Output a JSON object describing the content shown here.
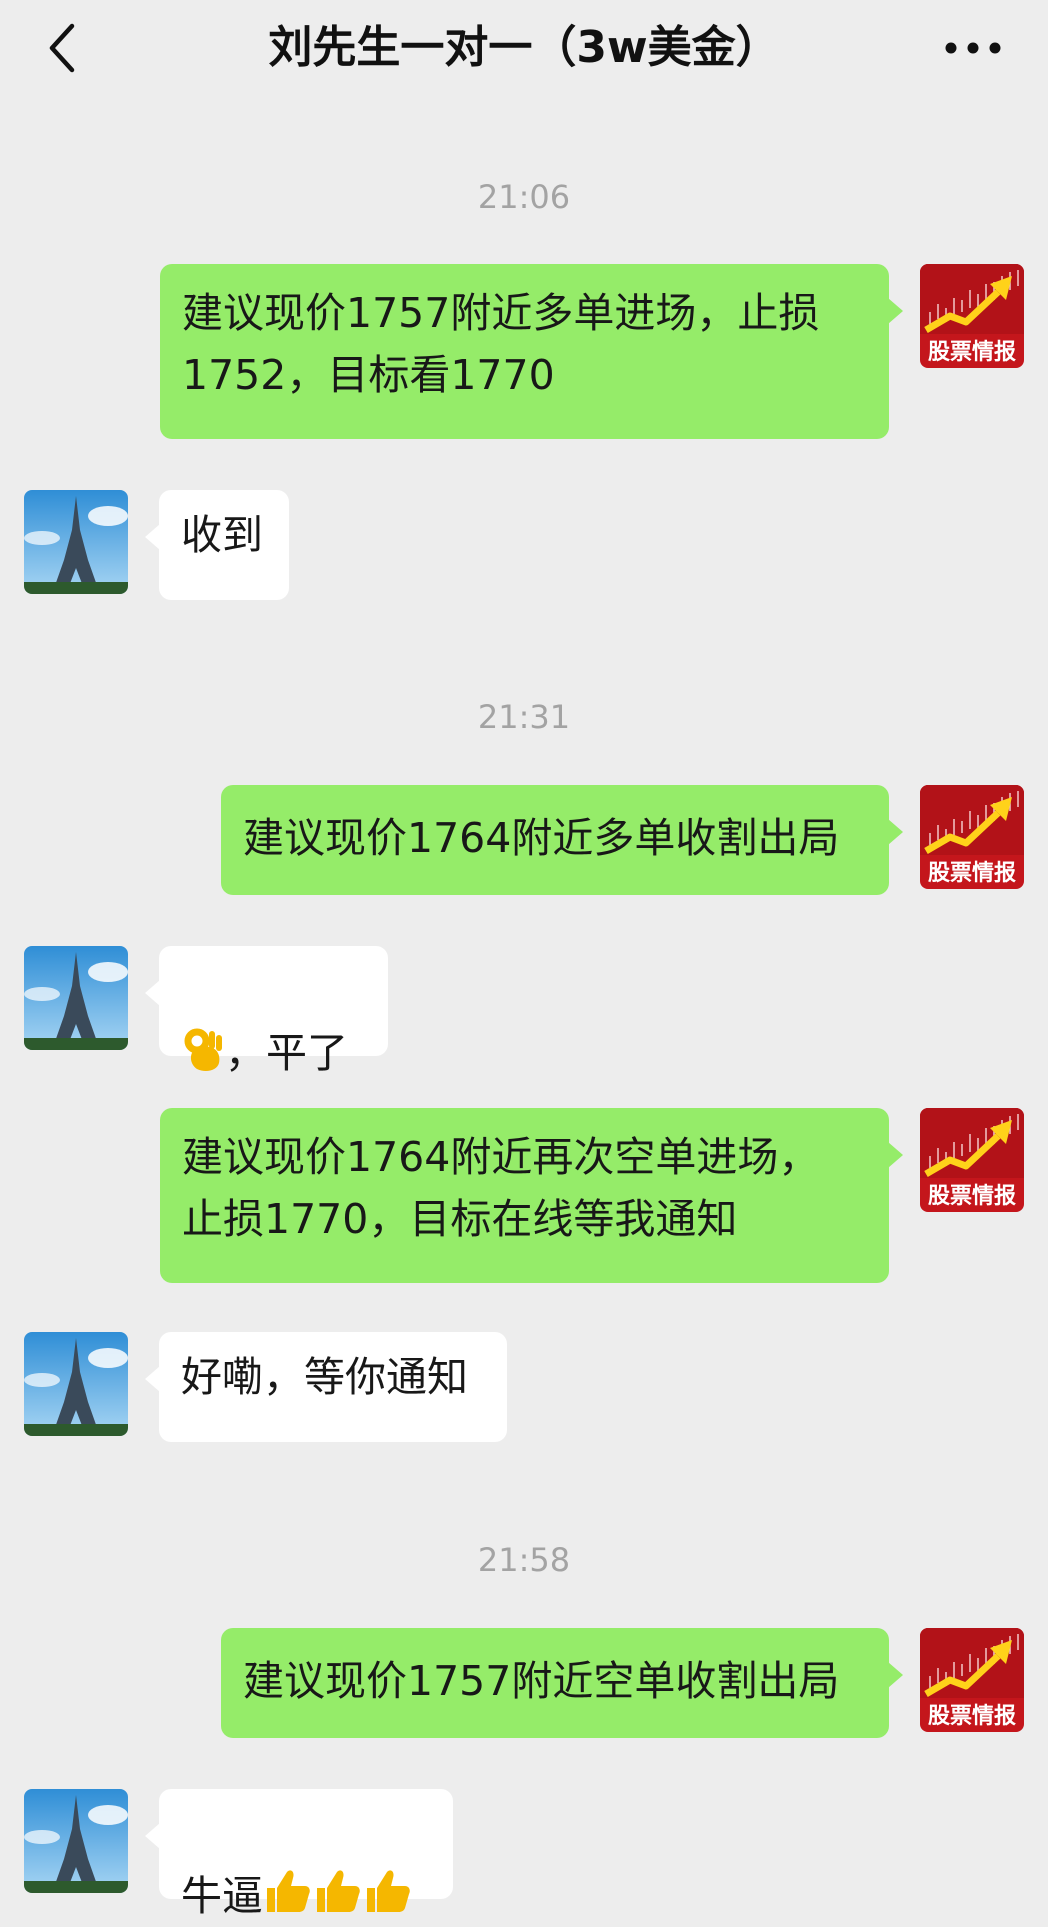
{
  "header": {
    "title": "刘先生一对一（3w美金）",
    "back_icon": "chevron-left-icon",
    "more_icon": "more-dots-icon"
  },
  "chat": {
    "times": [
      "21:06",
      "21:31",
      "21:58"
    ],
    "messages": [
      {
        "side": "out",
        "text": "建议现价1757附近多单进场，止损\n1752，目标看1770"
      },
      {
        "side": "in",
        "text": "收到"
      },
      {
        "side": "out",
        "text": "建议现价1764附近多单收割出局"
      },
      {
        "side": "in",
        "text": "，平了",
        "emoji": "ok-hand-emoji"
      },
      {
        "side": "out",
        "text": "建议现价1764附近再次空单进场，\n止损1770，目标在线等我通知"
      },
      {
        "side": "in",
        "text": "好嘞，等你通知"
      },
      {
        "side": "out",
        "text": "建议现价1757附近空单收割出局"
      },
      {
        "side": "in",
        "text": "牛逼",
        "emoji": "thumbs-up-emoji"
      }
    ]
  },
  "avatars": {
    "self_label": "股票情报",
    "self_avatar": "stock-chart-avatar",
    "contact_avatar": "eiffel-tower-avatar"
  },
  "colors": {
    "outgoing_bubble": "#95ec69",
    "incoming_bubble": "#ffffff",
    "background": "#ededed",
    "time_text": "#a3a3a3"
  }
}
